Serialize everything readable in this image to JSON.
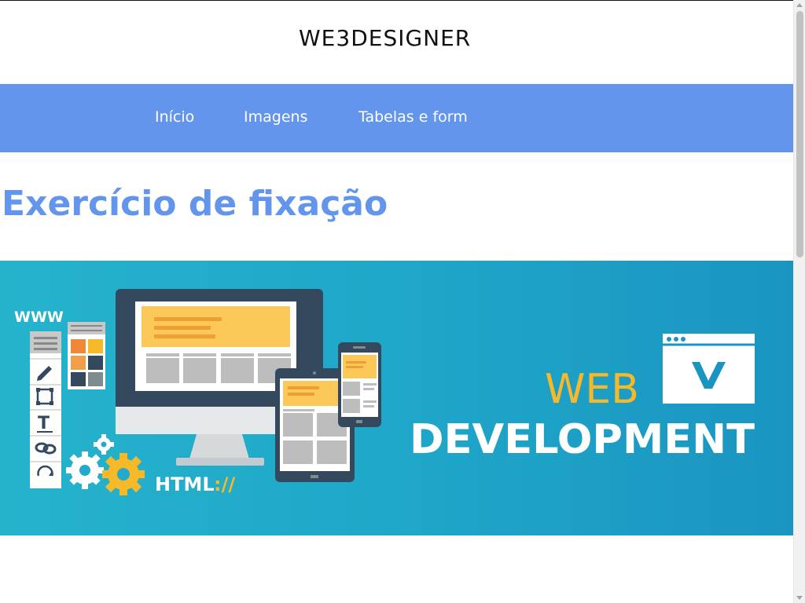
{
  "header": {
    "logo_text": "WE3DESIGNER"
  },
  "nav": {
    "items": [
      {
        "label": "Início"
      },
      {
        "label": "Imagens"
      },
      {
        "label": "Tabelas e form"
      }
    ]
  },
  "main": {
    "title": "Exercício de fixação",
    "banner": {
      "browser_text": "WWW",
      "html_label": "HTML",
      "html_slashes": "://",
      "word_web": "WEB",
      "word_development": "DEVELOPMENT"
    }
  },
  "colors": {
    "accent": "#6495ed",
    "nav_text": "#ffffff",
    "banner_bg": "#1fa7c9",
    "banner_orange": "#f7b928",
    "banner_white": "#ffffff"
  }
}
